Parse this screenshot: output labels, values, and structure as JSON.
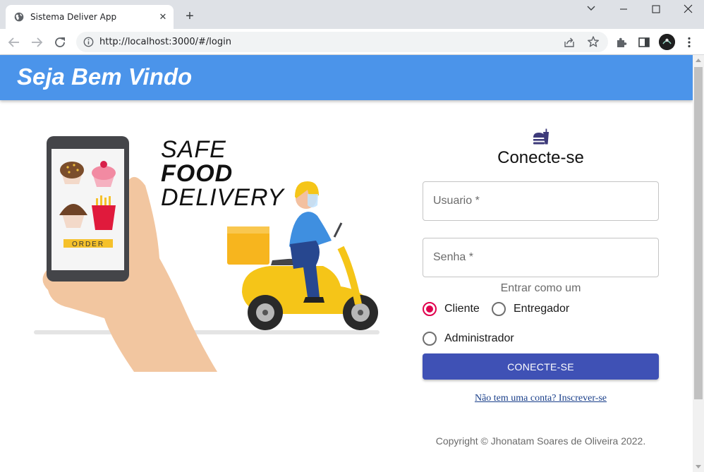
{
  "browser": {
    "tab_title": "Sistema Deliver App",
    "url": "http://localhost:3000/#/login"
  },
  "header": {
    "title": "Seja Bem Vindo"
  },
  "hero": {
    "line1": "SAFE",
    "line2": "FOOD",
    "line3": "DELIVERY",
    "order_label": "ORDER"
  },
  "login": {
    "title": "Conecte-se",
    "username_label": "Usuario *",
    "password_label": "Senha *",
    "role_label": "Entrar como um",
    "roles": [
      {
        "label": "Cliente",
        "checked": true
      },
      {
        "label": "Entregador",
        "checked": false
      },
      {
        "label": "Administrador",
        "checked": false
      }
    ],
    "submit_label": "CONECTE-SE",
    "signup_link": "Não tem uma conta? Inscrever-se",
    "copyright": "Copyright © Jhonatam Soares de Oliveira 2022."
  },
  "colors": {
    "header": "#4b94ea",
    "primary_button": "#3f51b5",
    "radio_selected": "#e0004d"
  }
}
